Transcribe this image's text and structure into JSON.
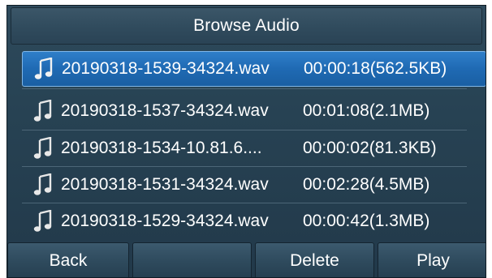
{
  "header": {
    "title": "Browse Audio"
  },
  "files": [
    {
      "name": "20190318-1539-34324.wav",
      "info": "00:00:18(562.5KB)",
      "selected": true
    },
    {
      "name": "20190318-1537-34324.wav",
      "info": "00:01:08(2.1MB)",
      "selected": false
    },
    {
      "name": "20190318-1534-10.81.6....",
      "info": "00:00:02(81.3KB)",
      "selected": false
    },
    {
      "name": "20190318-1531-34324.wav",
      "info": "00:02:28(4.5MB)",
      "selected": false
    },
    {
      "name": "20190318-1529-34324.wav",
      "info": "00:00:42(1.3MB)",
      "selected": false
    }
  ],
  "icons": {
    "file": "music-note-icon"
  },
  "colors": {
    "selection": "#1f6ab3",
    "background": "#274253",
    "text": "#ffffff"
  },
  "softkeys": {
    "back": "Back",
    "empty": "",
    "delete": "Delete",
    "play": "Play"
  }
}
